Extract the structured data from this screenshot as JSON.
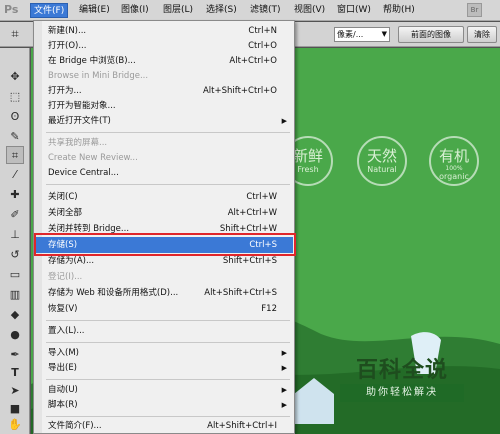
{
  "app": {
    "logo": "Ps"
  },
  "menubar": {
    "items": [
      "文件(F)",
      "编辑(E)",
      "图像(I)",
      "图层(L)",
      "选择(S)",
      "滤镜(T)",
      "视图(V)",
      "窗口(W)",
      "帮助(H)"
    ],
    "active_index": 0
  },
  "options_bar": {
    "unit_select": "像素/...",
    "front_image_button": "前面的图像",
    "clear_button": "清除"
  },
  "file_menu": {
    "items": [
      {
        "label": "新建(N)...",
        "shortcut": "Ctrl+N",
        "enabled": true
      },
      {
        "label": "打开(O)...",
        "shortcut": "Ctrl+O",
        "enabled": true
      },
      {
        "label": "在 Bridge 中浏览(B)...",
        "shortcut": "Alt+Ctrl+O",
        "enabled": true
      },
      {
        "label": "Browse in Mini Bridge...",
        "shortcut": "",
        "enabled": false
      },
      {
        "label": "打开为...",
        "shortcut": "Alt+Shift+Ctrl+O",
        "enabled": true
      },
      {
        "label": "打开为智能对象...",
        "shortcut": "",
        "enabled": true
      },
      {
        "label": "最近打开文件(T)",
        "shortcut": "",
        "enabled": true,
        "submenu": true
      },
      {
        "label": "共享我的屏幕...",
        "shortcut": "",
        "enabled": false
      },
      {
        "label": "Create New Review...",
        "shortcut": "",
        "enabled": false
      },
      {
        "label": "Device Central...",
        "shortcut": "",
        "enabled": true
      },
      {
        "label": "关闭(C)",
        "shortcut": "Ctrl+W",
        "enabled": true
      },
      {
        "label": "关闭全部",
        "shortcut": "Alt+Ctrl+W",
        "enabled": true
      },
      {
        "label": "关闭并转到 Bridge...",
        "shortcut": "Shift+Ctrl+W",
        "enabled": true
      },
      {
        "label": "存储(S)",
        "shortcut": "Ctrl+S",
        "enabled": true,
        "selected": true
      },
      {
        "label": "存储为(A)...",
        "shortcut": "Shift+Ctrl+S",
        "enabled": true
      },
      {
        "label": "登记(I)...",
        "shortcut": "",
        "enabled": false
      },
      {
        "label": "存储为 Web 和设备所用格式(D)...",
        "shortcut": "Alt+Shift+Ctrl+S",
        "enabled": true
      },
      {
        "label": "恢复(V)",
        "shortcut": "F12",
        "enabled": true
      },
      {
        "label": "置入(L)...",
        "shortcut": "",
        "enabled": true
      },
      {
        "label": "导入(M)",
        "shortcut": "",
        "enabled": true,
        "submenu": true
      },
      {
        "label": "导出(E)",
        "shortcut": "",
        "enabled": true,
        "submenu": true
      },
      {
        "label": "自动(U)",
        "shortcut": "",
        "enabled": true,
        "submenu": true
      },
      {
        "label": "脚本(R)",
        "shortcut": "",
        "enabled": true,
        "submenu": true
      },
      {
        "label": "文件简介(F)...",
        "shortcut": "Alt+Shift+Ctrl+I",
        "enabled": true
      }
    ],
    "submenu_arrow": "▶"
  },
  "canvas": {
    "badges": [
      {
        "big": "新鲜",
        "small": "Fresh",
        "tiny": ""
      },
      {
        "big": "天然",
        "small": "Natural",
        "tiny": ""
      },
      {
        "big": "有机",
        "small": "organic",
        "tiny": "100%"
      }
    ]
  },
  "watermark": {
    "title": "百科全说",
    "subtitle": "助你轻松解决"
  },
  "colors": {
    "menu_highlight": "#3b79d6",
    "annotation_box": "#e0262b",
    "canvas_green": "#4aa84a"
  }
}
